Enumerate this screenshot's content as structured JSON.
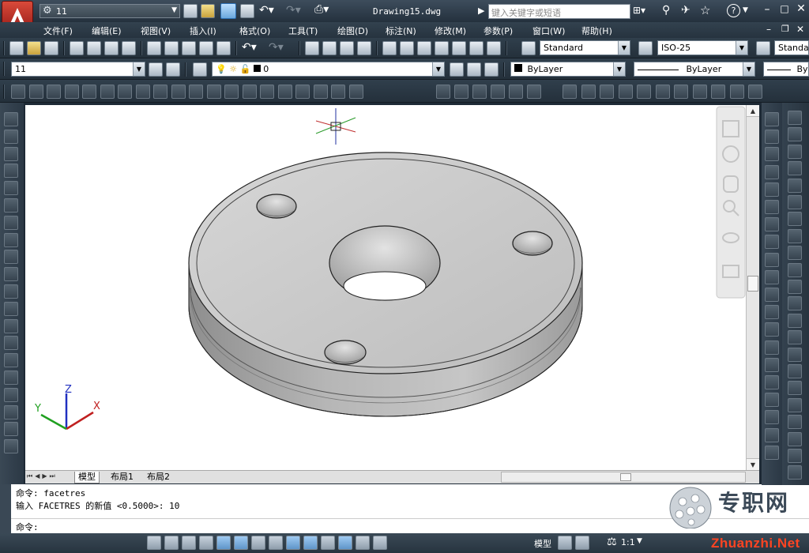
{
  "window": {
    "title": "Drawing15.dwg",
    "workspace_value": "11",
    "search_placeholder": "键入关键字或短语",
    "help_label": "?"
  },
  "menu": {
    "items": [
      "文件(F)",
      "编辑(E)",
      "视图(V)",
      "插入(I)",
      "格式(O)",
      "工具(T)",
      "绘图(D)",
      "标注(N)",
      "修改(M)",
      "参数(P)",
      "窗口(W)",
      "帮助(H)"
    ]
  },
  "styles": {
    "text_style": "Standard",
    "dim_style": "ISO-25",
    "table_style": "Standa"
  },
  "layers": {
    "workspace_combo": "11",
    "layer_value": "0",
    "color_value": "ByLayer",
    "linetype_value": "ByLayer",
    "lineweight_value": "By"
  },
  "ucs": {
    "x_label": "X",
    "y_label": "Y",
    "z_label": "Z"
  },
  "layout_tabs": [
    "模型",
    "布局1",
    "布局2"
  ],
  "command": {
    "line1": "命令: facetres",
    "line2": "输入 FACETRES 的新值 <0.5000>: 10",
    "prompt": "命令:"
  },
  "status": {
    "model_label": "模型",
    "scale_label": "1:1"
  },
  "watermark": {
    "cn": "专职网",
    "url": "Zhuanzhi.Net"
  },
  "colors": {
    "chrome_dark": "#26333f",
    "viewport_bg": "#ffffff",
    "part_gray": "#b8b8b8",
    "logo_red": "#c8201e"
  }
}
